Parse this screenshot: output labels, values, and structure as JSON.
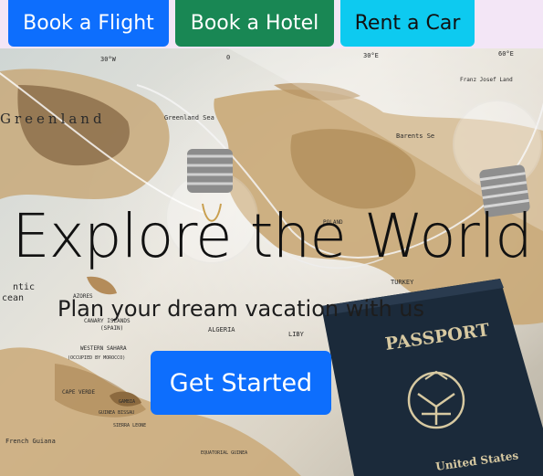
{
  "nav": {
    "flight_label": "Book a Flight",
    "hotel_label": "Book a Hotel",
    "car_label": "Rent a Car"
  },
  "hero": {
    "title": "Explore the World",
    "subtitle": "Plan your dream vacation with us",
    "cta_label": "Get Started",
    "image": {
      "map_labels": {
        "lon_1": "30°W",
        "lon_2": "0",
        "lon_3": "30°E",
        "lon_4": "60°E",
        "greenland": "Greenland",
        "greenland_sea": "Greenland Sea",
        "barents": "Barents Se",
        "franz_josef": "Franz Josef Land",
        "poland": "POLAND",
        "turkey": "TURKEY",
        "azores": "AZORES",
        "canary": "CANARY ISLANDS",
        "spain": "(SPAIN)",
        "algeria": "ALGERIA",
        "libya": "LIBY",
        "western_sahara": "WESTERN SAHARA",
        "occupied": "(OCCUPIED BY MOROCCO)",
        "cape_verde": "CAPE VERDE",
        "gambia": "GAMBIA",
        "guinea_bissau": "GUINEA BISSAU",
        "sierra_leone": "SIERRA LEONE",
        "french_guiana": "French Guiana",
        "equatorial_guinea": "EQUATORIAL GUINEA",
        "atlantic": "ntic",
        "ocean": "cean"
      },
      "passport_label": "PASSPORT",
      "passport_country": "United States"
    }
  },
  "colors": {
    "flight": "#0d6efd",
    "hotel": "#198754",
    "car": "#0dcaf0",
    "cta": "#0d6efd",
    "passport": "#1b2a3a",
    "gold": "#d7c9a1"
  }
}
